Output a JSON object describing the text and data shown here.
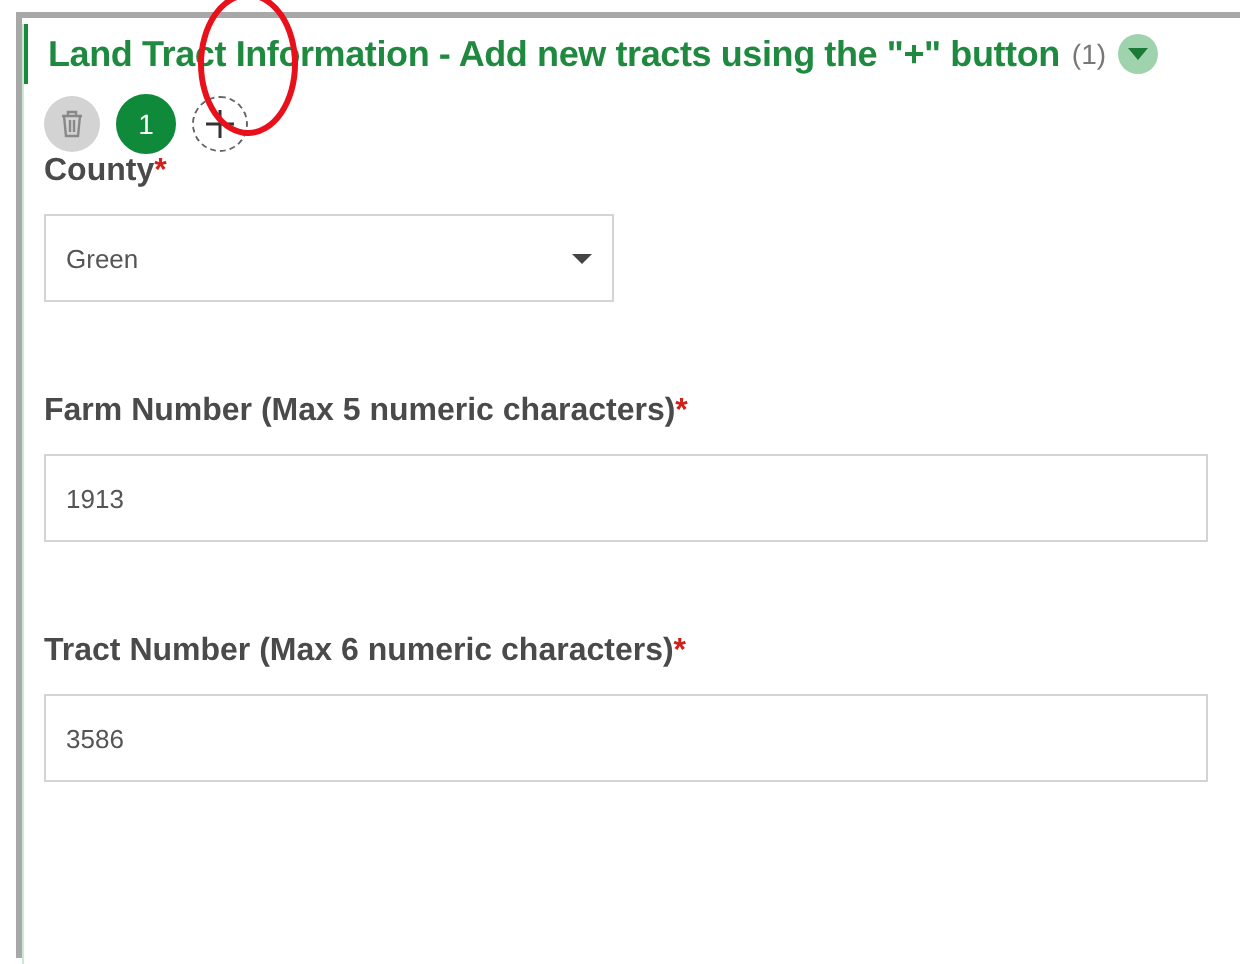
{
  "section": {
    "title": "Land Tract Information - Add new tracts using the \"+\" button",
    "count": "(1)",
    "expanded": true
  },
  "toolbar": {
    "pages": [
      {
        "label": "1",
        "selected": true
      }
    ],
    "add_highlighted": true
  },
  "fields": [
    {
      "kind": "select",
      "label": "County",
      "required_mark": "*",
      "value": "Green"
    },
    {
      "kind": "input",
      "label": "Farm Number (Max 5 numeric characters)",
      "required_mark": "*",
      "value": "1913"
    },
    {
      "kind": "input",
      "label": "Tract Number (Max 6 numeric characters)",
      "required_mark": "*",
      "value": "3586"
    }
  ]
}
